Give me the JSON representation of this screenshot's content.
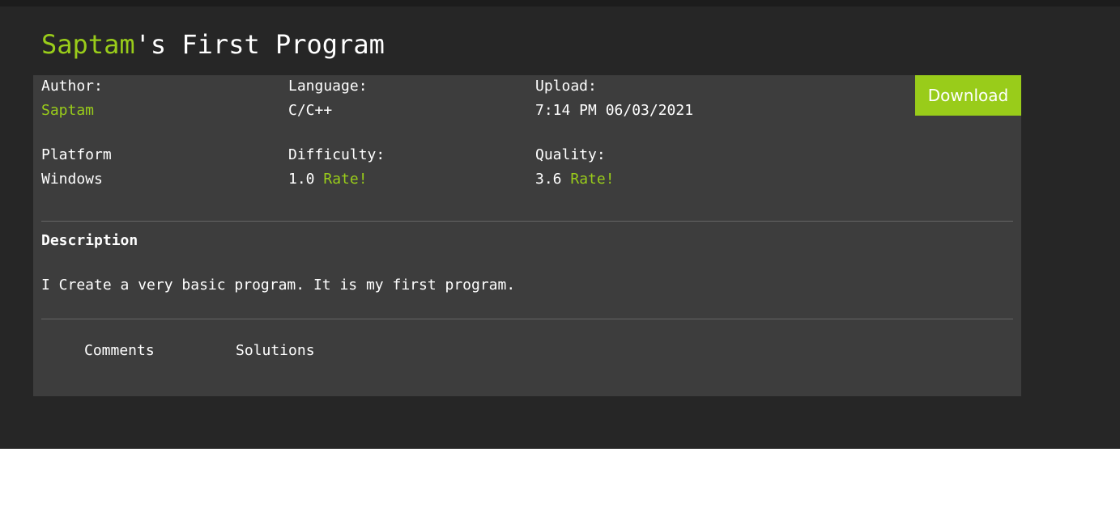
{
  "header": {
    "title_author": "Saptam",
    "title_rest": "'s First Program"
  },
  "meta": {
    "author_label": "Author:",
    "author_value": "Saptam",
    "language_label": "Language:",
    "language_value": "C/C++",
    "upload_label": "Upload:",
    "upload_value": "7:14 PM 06/03/2021",
    "platform_label": "Platform",
    "platform_value": "Windows",
    "difficulty_label": "Difficulty:",
    "difficulty_value": "1.0",
    "difficulty_rate": "Rate!",
    "quality_label": "Quality:",
    "quality_value": "3.6",
    "quality_rate": "Rate!"
  },
  "download_label": "Download",
  "description": {
    "title": "Description",
    "text": "I Create a very basic program. It is my first program."
  },
  "tabs": [
    {
      "label": "Comments"
    },
    {
      "label": "Solutions"
    }
  ],
  "colors": {
    "accent": "#99cc1a",
    "background": "#262626",
    "card": "#3d3d3d"
  }
}
